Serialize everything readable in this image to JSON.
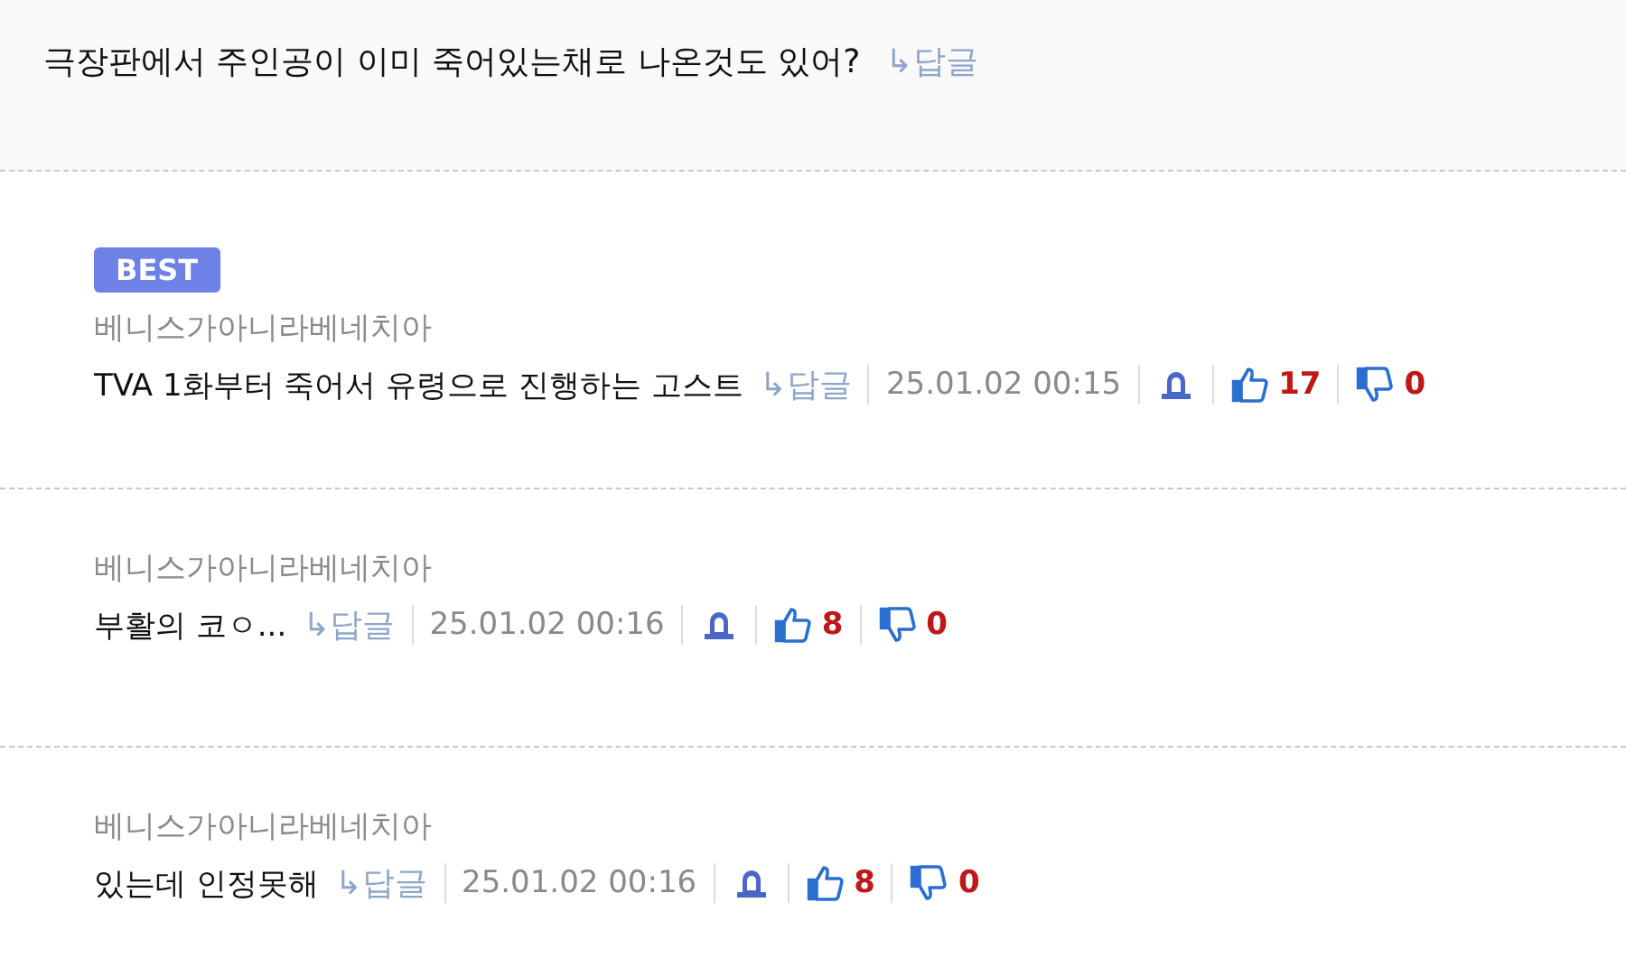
{
  "parent": {
    "text": "극장판에서 주인공이 이미 죽어있는채로 나온것도 있어?",
    "reply": "↳답글"
  },
  "comments": [
    {
      "best": true,
      "badge": "BEST",
      "author": "베니스가아니라베네치아",
      "text": "TVA 1화부터 죽어서 유령으로 진행하는 고스트",
      "reply": "↳답글",
      "time": "25.01.02 00:15",
      "likes": "17",
      "dislikes": "0"
    },
    {
      "best": false,
      "author": "베니스가아니라베네치아",
      "text": "부활의 코ㅇ...",
      "reply": "↳답글",
      "time": "25.01.02 00:16",
      "likes": "8",
      "dislikes": "0"
    },
    {
      "best": false,
      "author": "베니스가아니라베네치아",
      "text": "있는데 인정못해",
      "reply": "↳답글",
      "time": "25.01.02 00:16",
      "likes": "8",
      "dislikes": "0"
    }
  ]
}
